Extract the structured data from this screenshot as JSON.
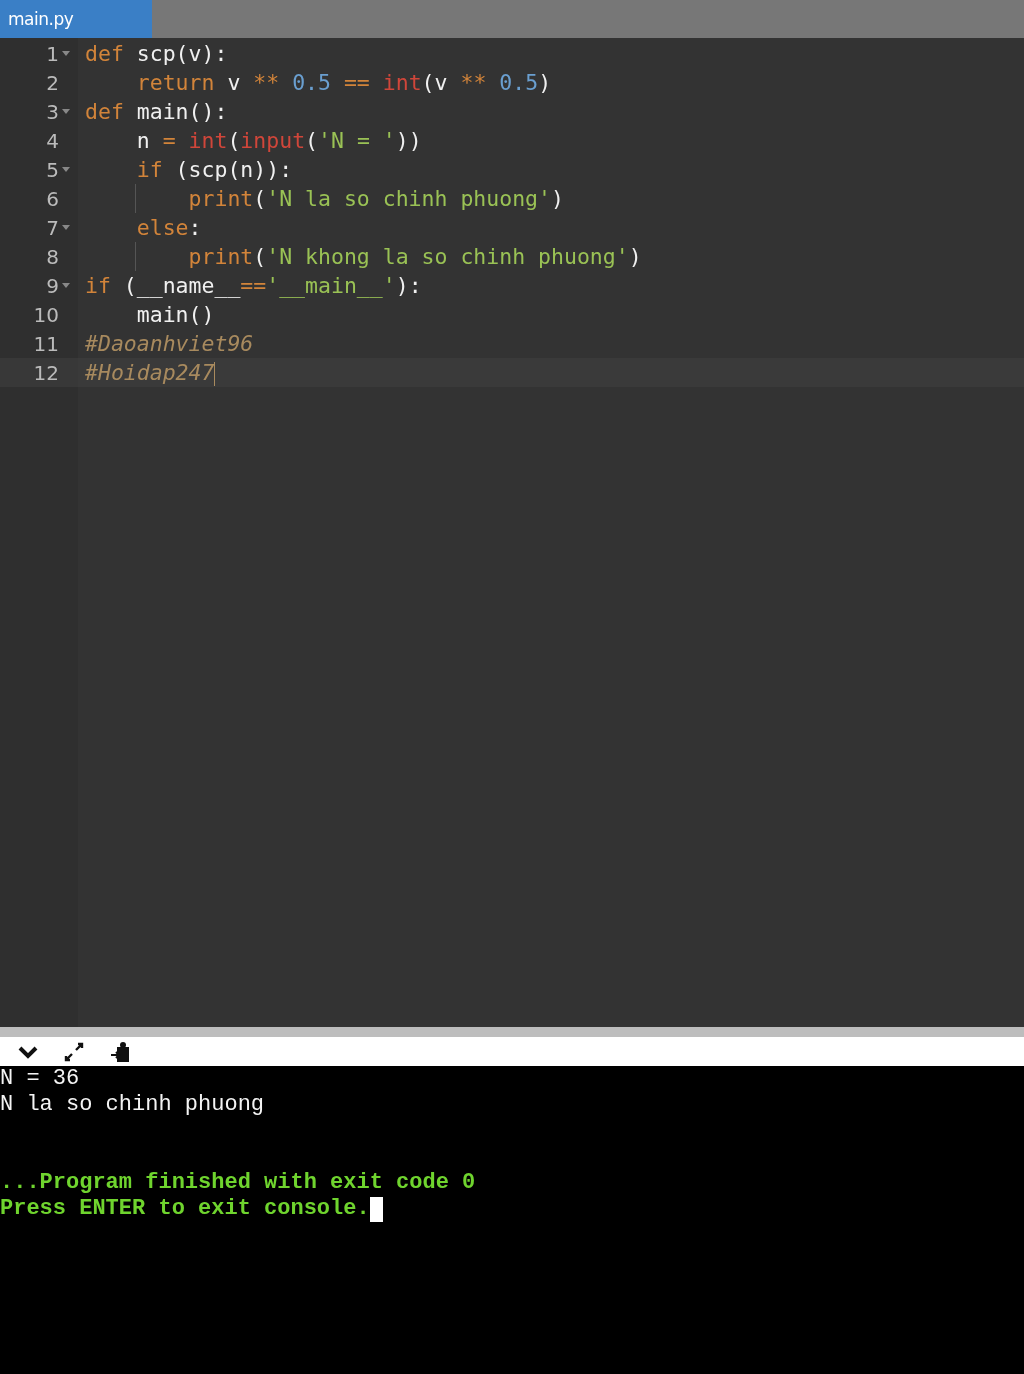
{
  "tabs": [
    {
      "label": "main.py",
      "selected": true
    }
  ],
  "editor": {
    "lines": [
      {
        "number": "1",
        "foldable": true,
        "current": false,
        "guide": false,
        "tokens": [
          {
            "kind": "keyword",
            "text": "def"
          },
          {
            "kind": "plain",
            "text": " scp(v):"
          }
        ]
      },
      {
        "number": "2",
        "foldable": false,
        "current": false,
        "guide": false,
        "tokens": [
          {
            "kind": "keyword",
            "text": "    return"
          },
          {
            "kind": "plain",
            "text": " v "
          },
          {
            "kind": "operator",
            "text": "** "
          },
          {
            "kind": "number",
            "text": "0.5"
          },
          {
            "kind": "operator",
            "text": " == "
          },
          {
            "kind": "builtin",
            "text": "int"
          },
          {
            "kind": "plain",
            "text": "(v "
          },
          {
            "kind": "operator",
            "text": "** "
          },
          {
            "kind": "number",
            "text": "0.5"
          },
          {
            "kind": "plain",
            "text": ")"
          }
        ]
      },
      {
        "number": "3",
        "foldable": true,
        "current": false,
        "guide": false,
        "tokens": [
          {
            "kind": "keyword",
            "text": "def"
          },
          {
            "kind": "plain",
            "text": " main():"
          }
        ]
      },
      {
        "number": "4",
        "foldable": false,
        "current": false,
        "guide": false,
        "tokens": [
          {
            "kind": "plain",
            "text": "    n "
          },
          {
            "kind": "operator",
            "text": "= "
          },
          {
            "kind": "builtin",
            "text": "int"
          },
          {
            "kind": "plain",
            "text": "("
          },
          {
            "kind": "builtin",
            "text": "input"
          },
          {
            "kind": "plain",
            "text": "("
          },
          {
            "kind": "string",
            "text": "'N = '"
          },
          {
            "kind": "plain",
            "text": "))"
          }
        ]
      },
      {
        "number": "5",
        "foldable": true,
        "current": false,
        "guide": false,
        "tokens": [
          {
            "kind": "keyword",
            "text": "    if"
          },
          {
            "kind": "plain",
            "text": " (scp(n)):"
          }
        ]
      },
      {
        "number": "6",
        "foldable": false,
        "current": false,
        "guide": true,
        "tokens": [
          {
            "kind": "keyword",
            "text": "    print"
          },
          {
            "kind": "plain",
            "text": "("
          },
          {
            "kind": "string",
            "text": "'N la so chinh phuong'"
          },
          {
            "kind": "plain",
            "text": ")"
          }
        ]
      },
      {
        "number": "7",
        "foldable": true,
        "current": false,
        "guide": false,
        "tokens": [
          {
            "kind": "keyword",
            "text": "    else"
          },
          {
            "kind": "plain",
            "text": ":"
          }
        ]
      },
      {
        "number": "8",
        "foldable": false,
        "current": false,
        "guide": true,
        "tokens": [
          {
            "kind": "keyword",
            "text": "    print"
          },
          {
            "kind": "plain",
            "text": "("
          },
          {
            "kind": "string",
            "text": "'N khong la so chinh phuong'"
          },
          {
            "kind": "plain",
            "text": ")"
          }
        ]
      },
      {
        "number": "9",
        "foldable": true,
        "current": false,
        "guide": false,
        "tokens": [
          {
            "kind": "keyword",
            "text": "if"
          },
          {
            "kind": "plain",
            "text": " (__name__"
          },
          {
            "kind": "operator",
            "text": "=="
          },
          {
            "kind": "string",
            "text": "'__main__'"
          },
          {
            "kind": "plain",
            "text": "):"
          }
        ]
      },
      {
        "number": "10",
        "foldable": false,
        "current": false,
        "guide": false,
        "tokens": [
          {
            "kind": "plain",
            "text": "    main()"
          }
        ]
      },
      {
        "number": "11",
        "foldable": false,
        "current": false,
        "guide": false,
        "tokens": [
          {
            "kind": "comment",
            "text": "#Daoanhviet96"
          }
        ]
      },
      {
        "number": "12",
        "foldable": false,
        "current": true,
        "guide": false,
        "tokens": [
          {
            "kind": "comment",
            "text": "#Hoidap247"
          }
        ]
      }
    ]
  },
  "console": {
    "output": [
      "N = 36",
      "N la so chinh phuong"
    ],
    "messages": [
      "...Program finished with exit code 0",
      "Press ENTER to exit console."
    ],
    "cursor": true
  }
}
